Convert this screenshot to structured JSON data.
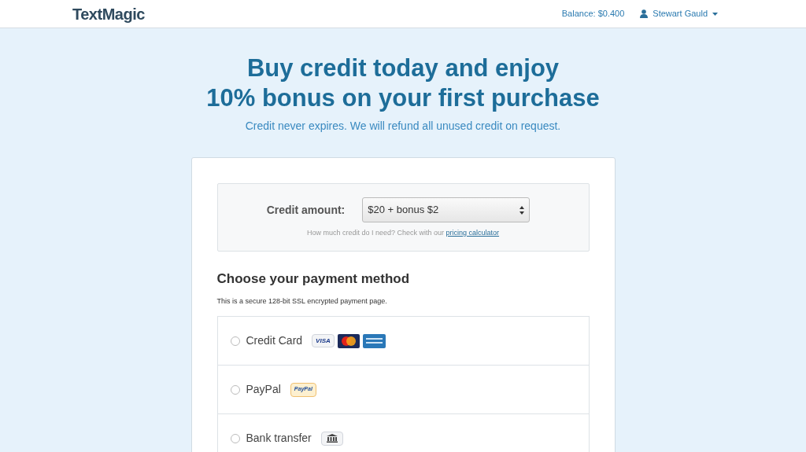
{
  "header": {
    "logo": "TextMagic",
    "balance": "Balance: $0.400",
    "user": "Stewart Gauld"
  },
  "hero": {
    "title_line1": "Buy credit today and enjoy",
    "title_line2": "10% bonus on your first purchase",
    "subtitle": "Credit never expires. We will refund all unused credit on request."
  },
  "credit": {
    "label": "Credit amount:",
    "value": "$20 + bonus $2",
    "help": "How much credit do I need? Check with our",
    "link": "pricing calculator"
  },
  "payment": {
    "title": "Choose your payment method",
    "note": "This is a secure 128-bit SSL encrypted payment page.",
    "methods": [
      {
        "label": "Credit Card",
        "kind": "card",
        "selected": false,
        "badge": "VISA"
      },
      {
        "label": "PayPal",
        "kind": "paypal",
        "selected": false,
        "badge": "PayPal"
      },
      {
        "label": "Bank transfer",
        "kind": "bank",
        "selected": false
      }
    ]
  }
}
